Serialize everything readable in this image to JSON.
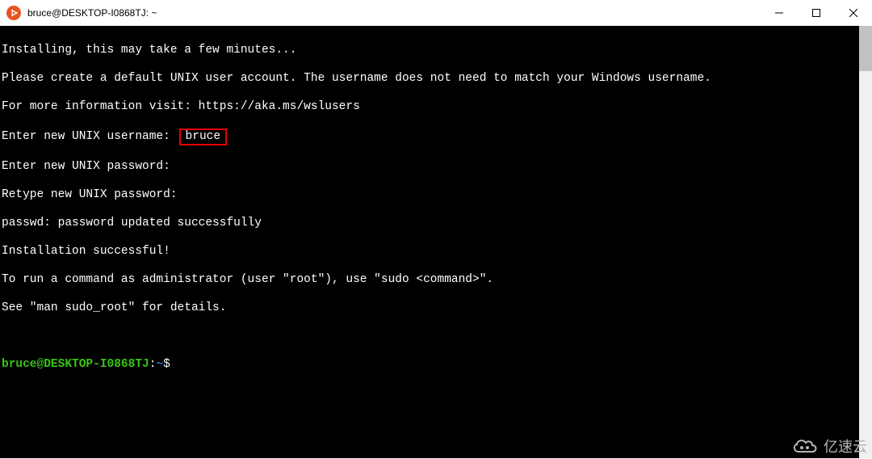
{
  "window": {
    "title": "bruce@DESKTOP-I0868TJ: ~"
  },
  "terminal": {
    "line1": "Installing, this may take a few minutes...",
    "line2": "Please create a default UNIX user account. The username does not need to match your Windows username.",
    "line3": "For more information visit: https://aka.ms/wslusers",
    "line4_prefix": "Enter new UNIX username: ",
    "line4_highlight": "bruce",
    "line5": "Enter new UNIX password:",
    "line6": "Retype new UNIX password:",
    "line7": "passwd: password updated successfully",
    "line8": "Installation successful!",
    "line9": "To run a command as administrator (user \"root\"), use \"sudo <command>\".",
    "line10": "See \"man sudo_root\" for details.",
    "prompt_user_host": "bruce@DESKTOP-I0868TJ",
    "prompt_colon": ":",
    "prompt_path": "~",
    "prompt_symbol": "$"
  },
  "watermark": {
    "text": "亿速云"
  }
}
